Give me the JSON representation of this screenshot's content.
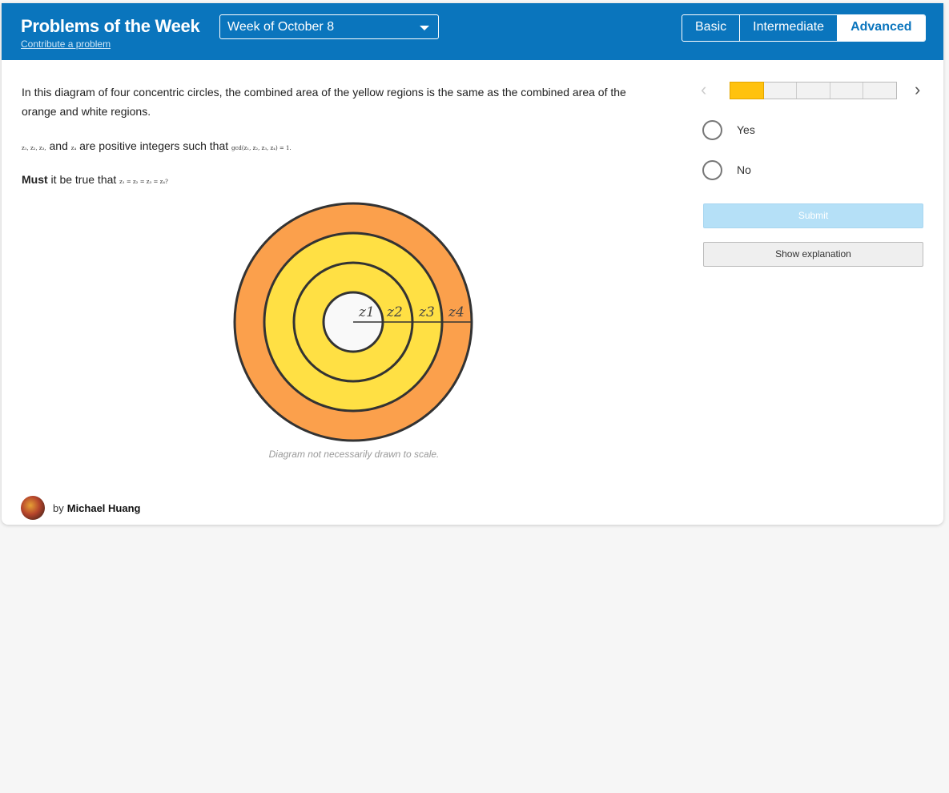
{
  "header": {
    "title": "Problems of the Week",
    "contribute_link": "Contribute a problem",
    "week_select": {
      "selected": "Week of October 8"
    },
    "levels": [
      "Basic",
      "Intermediate",
      "Advanced"
    ],
    "active_level": "Advanced",
    "background_color": "#0a75bd"
  },
  "problem": {
    "paragraph1": "In this diagram of four concentric circles, the combined area of the yellow regions is the same as the combined area of the orange and white regions.",
    "p2_vars": "z₁, z₂, z₃,",
    "p2_and": " and ",
    "p2_var4": "z₄",
    "p2_text": " are positive integers such that ",
    "p2_math": "gcd(z₁, z₂, z₃, z₄) = 1.",
    "p3_bold": "Must",
    "p3_text": " it be true that ",
    "p3_math": "z₁ = z₂ = z₃ = z₄?",
    "diagram_labels": [
      "z1",
      "z2",
      "z3",
      "z4"
    ],
    "diagram_colors": {
      "orange": "#fba04c",
      "yellow": "#ffe044",
      "white": "#f9f9f9",
      "stroke": "#333333"
    },
    "diagram_note": "Diagram not necessarily drawn to scale."
  },
  "author": {
    "prefix": "by",
    "name": "Michael Huang"
  },
  "sidebar": {
    "progress": {
      "total_segments": 5,
      "current": 1,
      "fill_color": "#ffc20e"
    },
    "prev_icon": "chevron-left-icon",
    "next_icon": "chevron-right-icon",
    "options": [
      "Yes",
      "No"
    ],
    "submit_label": "Submit",
    "explanation_label": "Show explanation"
  }
}
